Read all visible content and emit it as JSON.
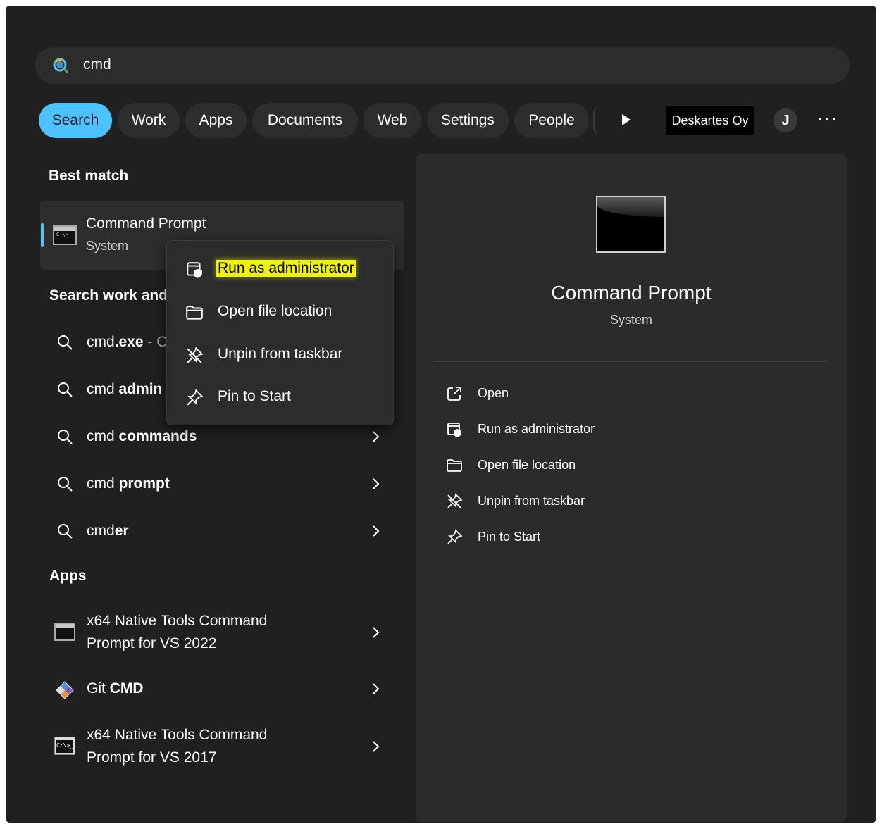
{
  "search": {
    "query": "cmd"
  },
  "filters": [
    "Search",
    "Work",
    "Apps",
    "Documents",
    "Web",
    "Settings",
    "People"
  ],
  "org_badge": "Deskartes Oy",
  "avatar_initial": "J",
  "more": "···",
  "best_match": {
    "section_title": "Best match",
    "title": "Command Prompt",
    "subtitle": "System",
    "icon_text": "C:\\>_"
  },
  "search_work": {
    "section_title": "Search work and",
    "items": [
      {
        "prefix": "cmd",
        "bold": ".exe",
        "suffix": " - C"
      },
      {
        "prefix": "cmd ",
        "bold": "admin",
        "suffix": ""
      },
      {
        "prefix": "cmd ",
        "bold": "commands",
        "suffix": ""
      },
      {
        "prefix": "cmd ",
        "bold": "prompt",
        "suffix": ""
      },
      {
        "prefix": "cmd",
        "bold": "er",
        "suffix": ""
      }
    ]
  },
  "apps": {
    "section_title": "Apps",
    "items": [
      {
        "line1": "x64 Native Tools Command",
        "line2": "Prompt for VS 2022",
        "icon": "cmd-small-icon"
      },
      {
        "prefix": "Git ",
        "bold": "CMD",
        "icon": "git-icon"
      },
      {
        "line1": "x64 Native Tools Command",
        "line2": "Prompt for VS 2017",
        "icon": "cmd-classic-icon"
      }
    ]
  },
  "context_menu": {
    "items": [
      {
        "label": "Run as administrator",
        "icon": "shield-window-icon",
        "highlighted": true
      },
      {
        "label": "Open file location",
        "icon": "folder-icon"
      },
      {
        "label": "Unpin from taskbar",
        "icon": "unpin-icon"
      },
      {
        "label": "Pin to Start",
        "icon": "pin-icon"
      }
    ]
  },
  "details": {
    "title": "Command Prompt",
    "subtitle": "System",
    "actions": [
      {
        "label": "Open",
        "icon": "open-external-icon"
      },
      {
        "label": "Run as administrator",
        "icon": "shield-window-icon"
      },
      {
        "label": "Open file location",
        "icon": "folder-icon"
      },
      {
        "label": "Unpin from taskbar",
        "icon": "unpin-icon"
      },
      {
        "label": "Pin to Start",
        "icon": "pin-icon"
      }
    ]
  },
  "colors": {
    "accent": "#4cc2ff",
    "highlight": "#f0f300",
    "background": "#202020"
  }
}
